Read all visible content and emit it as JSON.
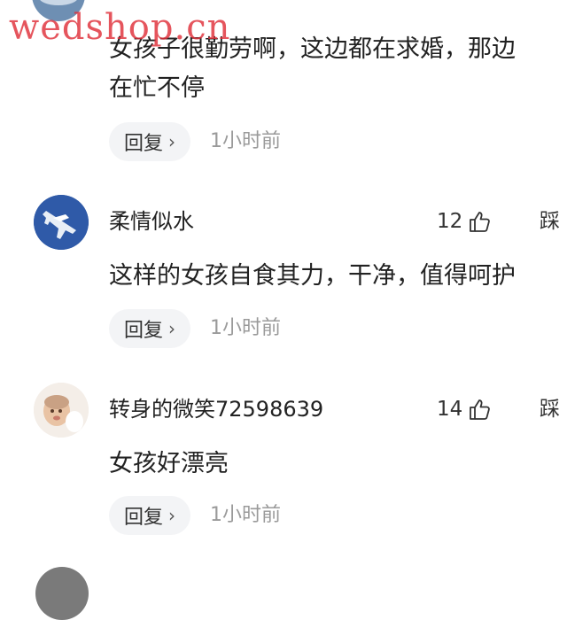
{
  "watermark": "wedshop.cn",
  "comment1": {
    "text_line1": "女孩子很勤劳啊，这边都在求婚，那边",
    "text_line2": "在忙不停",
    "reply_label": "回复",
    "time": "1小时前"
  },
  "comment2": {
    "username": "柔情似水",
    "likes": "12",
    "dislike_label": "踩",
    "text": "这样的女孩自食其力，干净，值得呵护",
    "reply_label": "回复",
    "time": "1小时前"
  },
  "comment3": {
    "username": "转身的微笑72598639",
    "likes": "14",
    "dislike_label": "踩",
    "text": "女孩好漂亮",
    "reply_label": "回复",
    "time": "1小时前"
  },
  "icons": {
    "chevron": "chevron-right-icon",
    "like": "thumbs-up-icon"
  },
  "colors": {
    "watermark": "#e0303a",
    "pill_bg": "#f3f4f6",
    "muted": "#9a9a9a",
    "avatar2_bg": "#2f5aa8"
  }
}
